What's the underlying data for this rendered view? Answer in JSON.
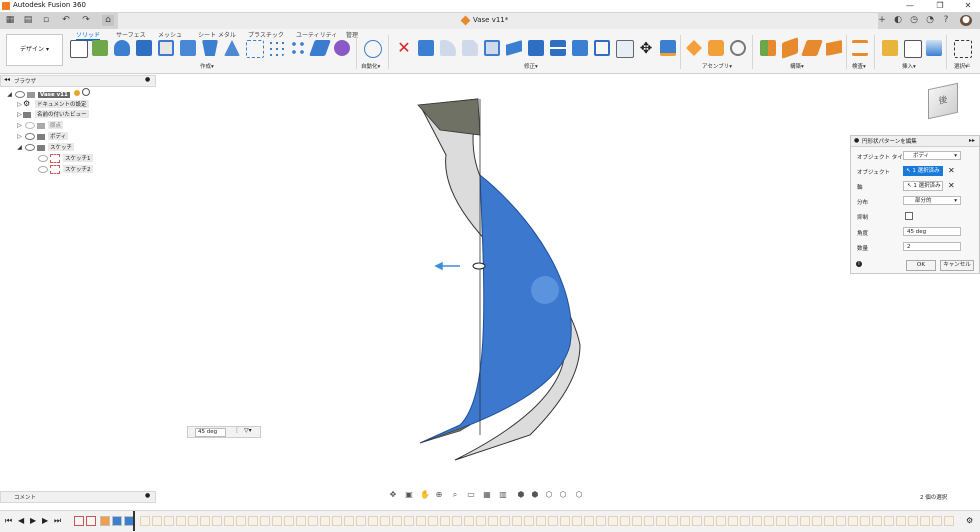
{
  "window": {
    "title": "Autodesk Fusion 360",
    "document_title": "Vase v11*",
    "controls": [
      "—",
      "❐",
      "✕"
    ]
  },
  "toolbar": {
    "workspace_button": "デザイン ▾",
    "tabs": [
      "ソリッド",
      "サーフェス",
      "メッシュ",
      "シート メタル",
      "プラスチック",
      "ユーティリティ",
      "管理"
    ],
    "active_tab": "ソリッド",
    "groups": {
      "create": "作成▾",
      "automate": "自動化▾",
      "modify": "修正▾",
      "assemble": "アセンブリ▾",
      "construct": "構築▾",
      "inspect": "検査▾",
      "insert": "挿入▾",
      "select": "選択▾"
    }
  },
  "browser": {
    "title": "ブラウザ",
    "root": "Vase v11",
    "items": [
      "ドキュメントの設定",
      "名前の付いたビュー",
      "原点",
      "ボディ",
      "スケッチ",
      "スケッチ1",
      "スケッチ2"
    ]
  },
  "dialog": {
    "title": "円形状パターンを編集",
    "rows": {
      "object_type_label": "オブジェクト タイプ",
      "object_type_value": "ボディ",
      "objects_label": "オブジェクト",
      "objects_value": "1 選択済み",
      "axis_label": "軸",
      "axis_value": "1 選択済み",
      "distribution_label": "分布",
      "distribution_value": "部分的",
      "suppress_label": "抑制",
      "angle_label": "角度",
      "angle_value": "45 deg",
      "quantity_label": "数量",
      "quantity_value": "2"
    },
    "ok": "OK",
    "cancel": "キャンセル"
  },
  "viewcube": {
    "face_label": "後"
  },
  "canvas": {
    "angle_input": "45 deg"
  },
  "bottom": {
    "comments": "コメント",
    "selection_status": "2 個の選択"
  },
  "colors": {
    "accent": "#1a7ad8",
    "body_blue": "#3d78cf",
    "body_gray": "#d9d9d9",
    "header_gray": "#6e7163"
  }
}
